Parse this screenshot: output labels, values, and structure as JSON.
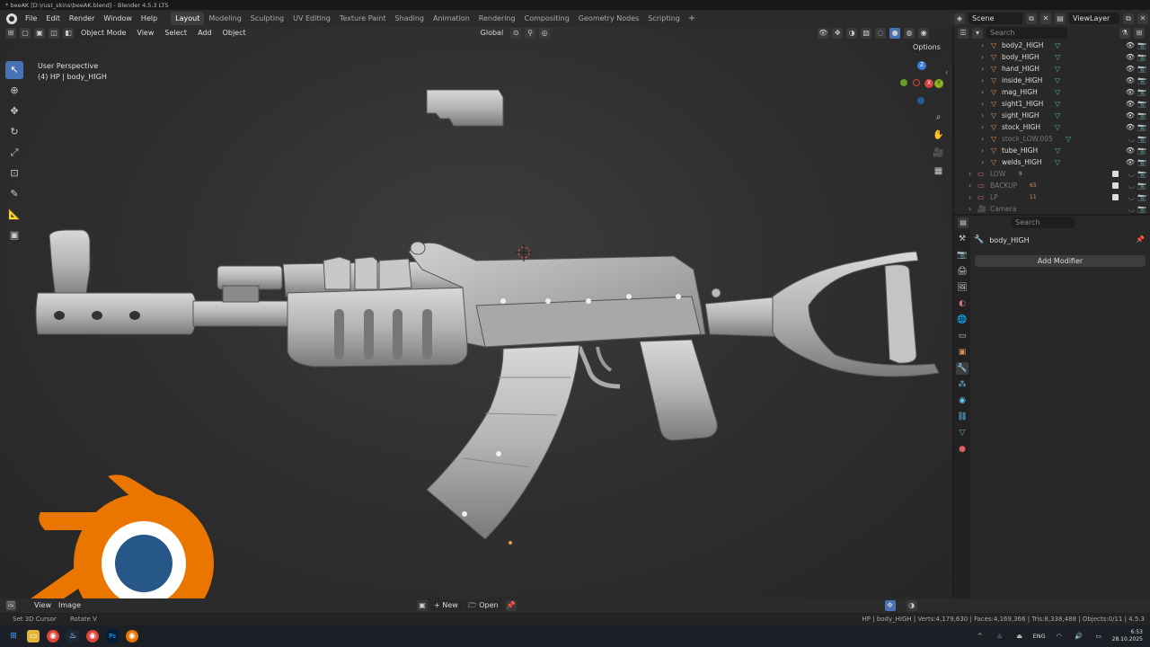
{
  "title": "* beeAK [D:\\rust_skins\\beeAK.blend] - Blender 4.5.3 LTS",
  "menus": [
    "File",
    "Edit",
    "Render",
    "Window",
    "Help"
  ],
  "workspaces": [
    "Layout",
    "Modeling",
    "Sculpting",
    "UV Editing",
    "Texture Paint",
    "Shading",
    "Animation",
    "Rendering",
    "Compositing",
    "Geometry Nodes",
    "Scripting"
  ],
  "active_workspace": "Layout",
  "scene": {
    "scene_label": "Scene",
    "viewlayer_label": "ViewLayer"
  },
  "viewport": {
    "mode": "Object Mode",
    "menus": [
      "View",
      "Select",
      "Add",
      "Object"
    ],
    "transform": "Global",
    "options": "Options",
    "info_line1": "User Perspective",
    "info_line2": "(4) HP | body_HIGH",
    "axis": {
      "z": "Z",
      "y": "Y",
      "x": "X"
    }
  },
  "outliner": {
    "search_placeholder": "Search",
    "items": [
      {
        "label": "body2_HIGH",
        "dim": false
      },
      {
        "label": "body_HIGH",
        "dim": false
      },
      {
        "label": "hand_HIGH",
        "dim": false
      },
      {
        "label": "inside_HIGH",
        "dim": false
      },
      {
        "label": "mag_HIGH",
        "dim": false
      },
      {
        "label": "sight1_HIGH",
        "dim": false
      },
      {
        "label": "sight_HIGH",
        "dim": false
      },
      {
        "label": "stock_HIGH",
        "dim": false
      },
      {
        "label": "stock_LOW.005",
        "dim": true
      },
      {
        "label": "tube_HIGH",
        "dim": false
      },
      {
        "label": "welds_HIGH",
        "dim": false
      }
    ],
    "collections": [
      {
        "label": "LOW",
        "count": "8"
      },
      {
        "label": "BACKUP",
        "count": "65"
      },
      {
        "label": "LP",
        "count": "11"
      },
      {
        "label": "Camera",
        "count": ""
      }
    ]
  },
  "properties": {
    "search_placeholder": "Search",
    "object_name": "body_HIGH",
    "add_modifier": "Add Modifier"
  },
  "image_editor": {
    "menus": [
      "View",
      "Image"
    ],
    "new": "New",
    "open": "Open"
  },
  "status": {
    "left1": "Set 3D Cursor",
    "left2": "Rotate V",
    "right": "HP | body_HIGH | Verts:4,179,630 | Faces:4,169,366 | Tris:8,338,488 | Objects:0/11 | 4.5.3"
  },
  "taskbar": {
    "lang": "ENG",
    "time": "6:53",
    "date": "28.10.2025"
  },
  "colors": {
    "accent": "#4772b3",
    "object_orange": "#e09050",
    "mesh_green": "#4ec07a",
    "blender_orange": "#ea7600",
    "blender_blue": "#265787"
  }
}
